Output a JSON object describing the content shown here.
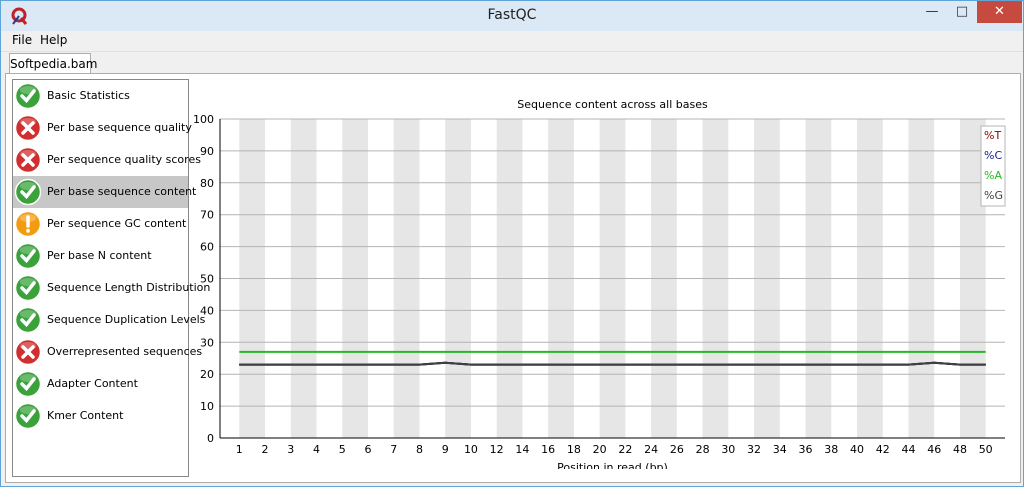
{
  "window": {
    "title": "FastQC"
  },
  "menu": {
    "items": [
      "File",
      "Help"
    ]
  },
  "tabs": [
    {
      "label": "Softpedia.bam"
    }
  ],
  "modules": [
    {
      "label": "Basic Statistics",
      "status": "pass"
    },
    {
      "label": "Per base sequence quality",
      "status": "fail"
    },
    {
      "label": "Per sequence quality scores",
      "status": "fail"
    },
    {
      "label": "Per base sequence content",
      "status": "pass",
      "selected": true
    },
    {
      "label": "Per sequence GC content",
      "status": "warn"
    },
    {
      "label": "Per base N content",
      "status": "pass"
    },
    {
      "label": "Sequence Length Distribution",
      "status": "pass"
    },
    {
      "label": "Sequence Duplication Levels",
      "status": "pass"
    },
    {
      "label": "Overrepresented sequences",
      "status": "fail"
    },
    {
      "label": "Adapter Content",
      "status": "pass"
    },
    {
      "label": "Kmer Content",
      "status": "pass"
    }
  ],
  "colors": {
    "pass": "#3aa23a",
    "fail": "#d12f2f",
    "warn": "#f39c12"
  },
  "chart_data": {
    "type": "line",
    "title": "Sequence content across all bases",
    "xlabel": "Position in read (bp)",
    "ylabel": "",
    "ylim": [
      0,
      100
    ],
    "yticks": [
      0,
      10,
      20,
      30,
      40,
      50,
      60,
      70,
      80,
      90,
      100
    ],
    "categories": [
      "1",
      "2",
      "3",
      "4",
      "5",
      "6",
      "7",
      "8",
      "9",
      "10",
      "12",
      "14",
      "16",
      "18",
      "20",
      "22",
      "24",
      "26",
      "28",
      "30",
      "32",
      "34",
      "36",
      "38",
      "40",
      "42",
      "44",
      "46",
      "48",
      "50"
    ],
    "legend_placement": "top-right",
    "series": [
      {
        "name": "%T",
        "color": "#8b0000",
        "values": [
          23,
          23,
          23,
          23,
          23,
          23,
          23,
          23,
          23.6,
          23,
          23,
          23,
          23,
          23,
          23,
          23,
          23,
          23,
          23,
          23,
          23,
          23,
          23,
          23,
          23,
          23,
          23,
          23.6,
          23,
          23
        ]
      },
      {
        "name": "%C",
        "color": "#1a1a8c",
        "values": [
          23,
          23,
          23,
          23,
          23,
          23,
          23,
          23,
          23.6,
          23,
          23,
          23,
          23,
          23,
          23,
          23,
          23,
          23,
          23,
          23,
          23,
          23,
          23,
          23,
          23,
          23,
          23,
          23.6,
          23,
          23
        ]
      },
      {
        "name": "%A",
        "color": "#22bb22",
        "values": [
          27,
          27,
          27,
          27,
          27,
          27,
          27,
          27,
          27,
          27,
          27,
          27,
          27,
          27,
          27,
          27,
          27,
          27,
          27,
          27,
          27,
          27,
          27,
          27,
          27,
          27,
          27,
          27,
          27,
          27
        ]
      },
      {
        "name": "%G",
        "color": "#404040",
        "values": [
          23,
          23,
          23,
          23,
          23,
          23,
          23,
          23,
          23.6,
          23,
          23,
          23,
          23,
          23,
          23,
          23,
          23,
          23,
          23,
          23,
          23,
          23,
          23,
          23,
          23,
          23,
          23,
          23.6,
          23,
          23
        ]
      }
    ]
  }
}
